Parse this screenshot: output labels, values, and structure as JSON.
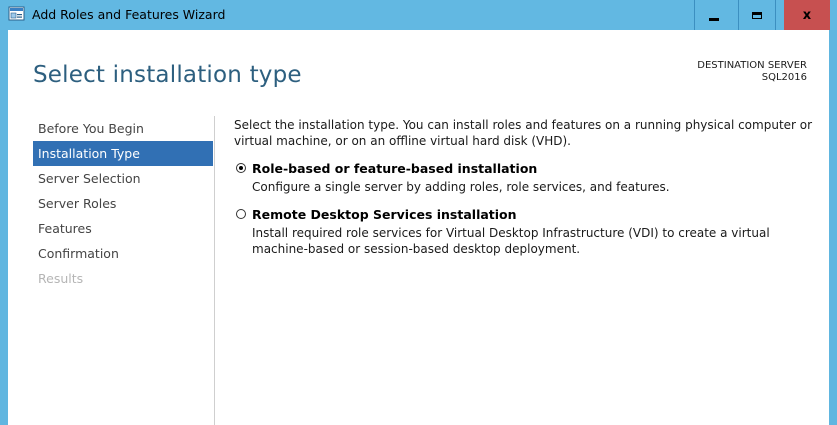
{
  "window": {
    "title": "Add Roles and Features Wizard",
    "icons": {
      "app": "server-manager-icon",
      "minimize": "minimize-icon",
      "maximize": "maximize-icon",
      "close": "close-icon"
    },
    "close_glyph": "x"
  },
  "header": {
    "page_title": "Select installation type",
    "destination_label": "DESTINATION SERVER",
    "destination_server": "SQL2016"
  },
  "nav": {
    "items": [
      {
        "label": "Before You Begin",
        "state": "normal"
      },
      {
        "label": "Installation Type",
        "state": "active"
      },
      {
        "label": "Server Selection",
        "state": "normal"
      },
      {
        "label": "Server Roles",
        "state": "normal"
      },
      {
        "label": "Features",
        "state": "normal"
      },
      {
        "label": "Confirmation",
        "state": "normal"
      },
      {
        "label": "Results",
        "state": "disabled"
      }
    ]
  },
  "content": {
    "intro": "Select the installation type. You can install roles and features on a running physical computer or virtual machine, or on an offline virtual hard disk (VHD).",
    "options": [
      {
        "title": "Role-based or feature-based installation",
        "description": "Configure a single server by adding roles, role services, and features.",
        "selected": true
      },
      {
        "title": "Remote Desktop Services installation",
        "description": "Install required role services for Virtual Desktop Infrastructure (VDI) to create a virtual machine-based or session-based desktop deployment.",
        "selected": false
      }
    ]
  },
  "colors": {
    "titlebar": "#62b8e2",
    "close_button": "#c75050",
    "nav_active": "#3170b4",
    "page_title": "#2d5f7f"
  }
}
